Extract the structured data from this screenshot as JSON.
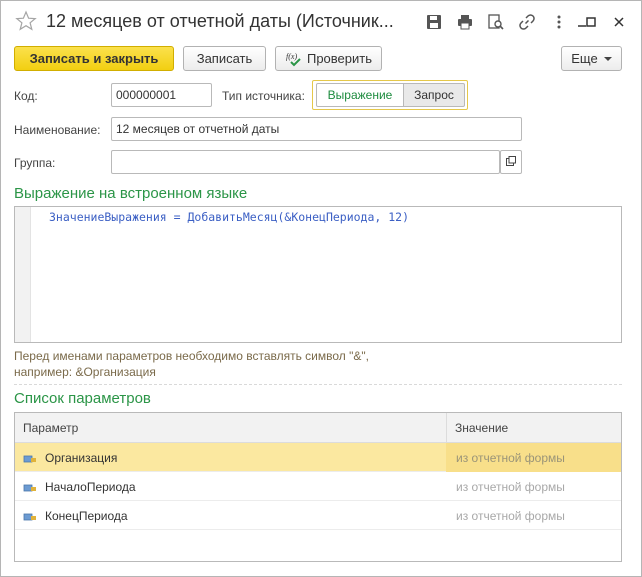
{
  "window": {
    "title": "12 месяцев от отчетной даты (Источник..."
  },
  "toolbar": {
    "save_close_label": "Записать и закрыть",
    "save_label": "Записать",
    "check_label": "Проверить",
    "more_label": "Еще"
  },
  "form": {
    "code_label": "Код:",
    "code_value": "000000001",
    "source_type_label": "Тип источника:",
    "source_type_options": [
      "Выражение",
      "Запрос"
    ],
    "source_type_selected": "Выражение",
    "name_label": "Наименование:",
    "name_value": "12 месяцев от отчетной даты",
    "group_label": "Группа:",
    "group_value": ""
  },
  "expression": {
    "section_title": "Выражение на встроенном языке",
    "code": "ЗначениеВыражения = ДобавитьМесяц(&КонецПериода, 12)",
    "hint_line1": "Перед именами параметров необходимо вставлять символ \"&\",",
    "hint_line2": "например: &Организация"
  },
  "params": {
    "section_title": "Список параметров",
    "columns": [
      "Параметр",
      "Значение"
    ],
    "rows": [
      {
        "name": "Организация",
        "value": "из отчетной формы",
        "selected": true
      },
      {
        "name": "НачалоПериода",
        "value": "из отчетной формы",
        "selected": false
      },
      {
        "name": "КонецПериода",
        "value": "из отчетной формы",
        "selected": false
      }
    ]
  },
  "colors": {
    "accent_green": "#2b9547",
    "primary_button": "#f2cf11",
    "selected_row": "#fbe8a0",
    "code_text": "#3b5fc4"
  },
  "icons": {
    "favorite": "star-icon",
    "save": "floppy-icon",
    "print": "printer-icon",
    "search": "search-doc-icon",
    "link": "link-icon",
    "more": "kebab-icon",
    "minimize": "minimize-icon",
    "maximize": "maximize-icon",
    "close": "close-icon",
    "check": "fx-check-icon",
    "param": "param-icon"
  }
}
